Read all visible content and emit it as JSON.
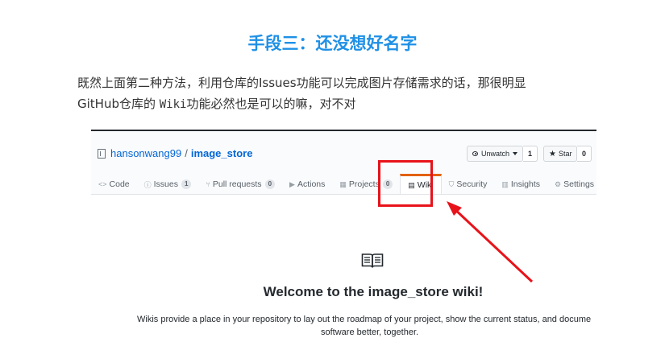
{
  "article": {
    "heading": "手段三：还没想好名字",
    "paragraph_line1": "既然上面第二种方法，利用仓库的Issues功能可以完成图片存储需求的话，那很明显",
    "paragraph_line2_pre": "GitHub仓库的 ",
    "paragraph_line2_code": "Wiki",
    "paragraph_line2_post": "功能必然也是可以的嘛，对不对"
  },
  "repo": {
    "owner": "hansonwang99",
    "separator": "/",
    "name": "image_store",
    "watch_label": "Unwatch",
    "watch_count": "1",
    "star_label": "Star",
    "star_count": "0"
  },
  "tabs": [
    {
      "icon": "<>",
      "label": "Code",
      "count": ""
    },
    {
      "icon": "ⓘ",
      "label": "Issues",
      "count": "1"
    },
    {
      "icon": "⑂",
      "label": "Pull requests",
      "count": "0"
    },
    {
      "icon": "▶",
      "label": "Actions",
      "count": ""
    },
    {
      "icon": "▦",
      "label": "Projects",
      "count": "0"
    },
    {
      "icon": "▤",
      "label": "Wiki",
      "count": ""
    },
    {
      "icon": "⛉",
      "label": "Security",
      "count": ""
    },
    {
      "icon": "▥",
      "label": "Insights",
      "count": ""
    },
    {
      "icon": "⚙",
      "label": "Settings",
      "count": ""
    }
  ],
  "wiki": {
    "welcome": "Welcome to the image_store wiki!",
    "desc_line1": "Wikis provide a place in your repository to lay out the roadmap of your project, show the current status, and docume",
    "desc_line2": "software better, together."
  },
  "colors": {
    "heading": "#1e90e6",
    "highlight": "#e8131a",
    "selected_tab_accent": "#e36209",
    "link": "#0366d6"
  }
}
